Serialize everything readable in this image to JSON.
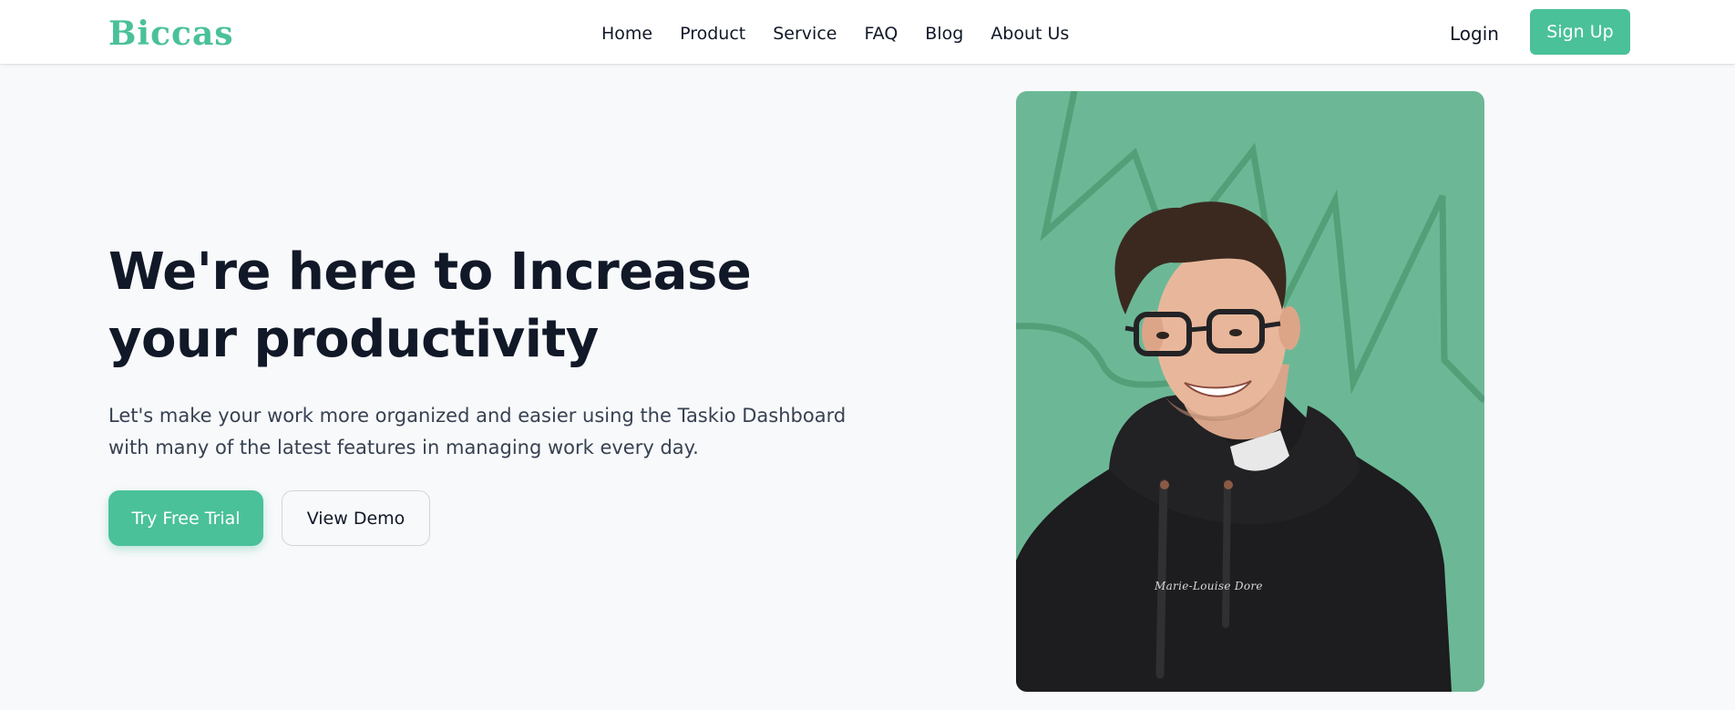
{
  "brand": {
    "logo": "Biccas",
    "accent_color": "#4ac199"
  },
  "nav": {
    "items": [
      "Home",
      "Product",
      "Service",
      "FAQ",
      "Blog",
      "About Us"
    ],
    "login_label": "Login",
    "signup_label": "Sign Up"
  },
  "hero": {
    "title": "We're here to Increase your productivity",
    "subtitle": "Let's make your work more organized and easier using the Taskio Dashboard with many of the latest features in managing work every day.",
    "primary_cta": "Try Free Trial",
    "secondary_cta": "View Demo",
    "image": {
      "alt": "Smiling man with glasses wearing a black hoodie on a green background",
      "background_color": "#6cb896",
      "hoodie_print": "Marie-Louise Dore"
    }
  }
}
